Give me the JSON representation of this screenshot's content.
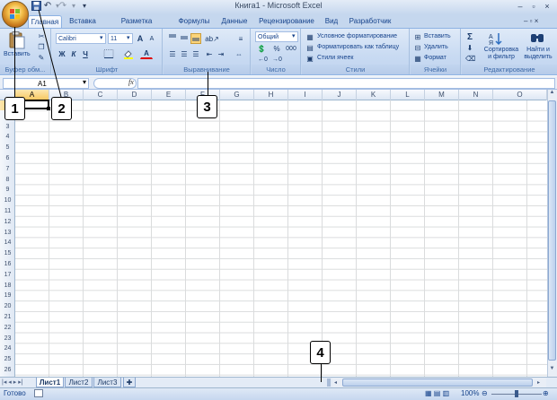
{
  "window": {
    "title": "Книга1 - Microsoft Excel"
  },
  "quick_access": {
    "save_icon": "save-icon",
    "undo_icon": "undo-icon",
    "redo_icon": "redo-icon",
    "customize_icon": "customize-qat-icon"
  },
  "window_controls": {
    "help": "?",
    "minimize": "–",
    "restore": "▫",
    "close": "×"
  },
  "tabs": [
    "Главная",
    "Вставка",
    "Разметка страницы",
    "Формулы",
    "Данные",
    "Рецензирование",
    "Вид",
    "Разработчик"
  ],
  "active_tab": "Главная",
  "ribbon": {
    "clipboard": {
      "label": "Буфер обм...",
      "paste": "Вставить"
    },
    "font": {
      "label": "Шрифт",
      "font_name": "Calibri",
      "font_size": "11",
      "bold": "Ж",
      "italic": "К",
      "underline": "Ч",
      "grow": "A",
      "shrink": "A"
    },
    "alignment": {
      "label": "Выравнивание"
    },
    "number": {
      "label": "Число",
      "format": "Общий",
      "percent": "%",
      "thousands": "000"
    },
    "styles": {
      "label": "Стили",
      "conditional": "Условное форматирование",
      "as_table": "Форматировать как таблицу",
      "cell_styles": "Стили ячеек"
    },
    "cells": {
      "label": "Ячейки",
      "insert": "Вставить",
      "delete": "Удалить",
      "format": "Формат"
    },
    "editing": {
      "label": "Редактирование",
      "sum": "Σ",
      "sort": "Сортировка и фильтр",
      "find": "Найти и выделить"
    }
  },
  "formula_bar": {
    "name_box": "A1",
    "fx": "fx",
    "formula": ""
  },
  "columns": [
    "A",
    "B",
    "C",
    "D",
    "E",
    "F",
    "G",
    "H",
    "I",
    "J",
    "K",
    "L",
    "M",
    "N",
    "O"
  ],
  "rows": [
    "1",
    "2",
    "3",
    "4",
    "5",
    "6",
    "7",
    "8",
    "9",
    "10",
    "11",
    "12",
    "13",
    "14",
    "15",
    "16",
    "17",
    "18",
    "19",
    "20",
    "21",
    "22",
    "23",
    "24",
    "25",
    "26"
  ],
  "sheets": [
    "Лист1",
    "Лист2",
    "Лист3"
  ],
  "status": {
    "ready": "Готово",
    "zoom": "100%"
  },
  "callouts": [
    "1",
    "2",
    "3",
    "4"
  ]
}
